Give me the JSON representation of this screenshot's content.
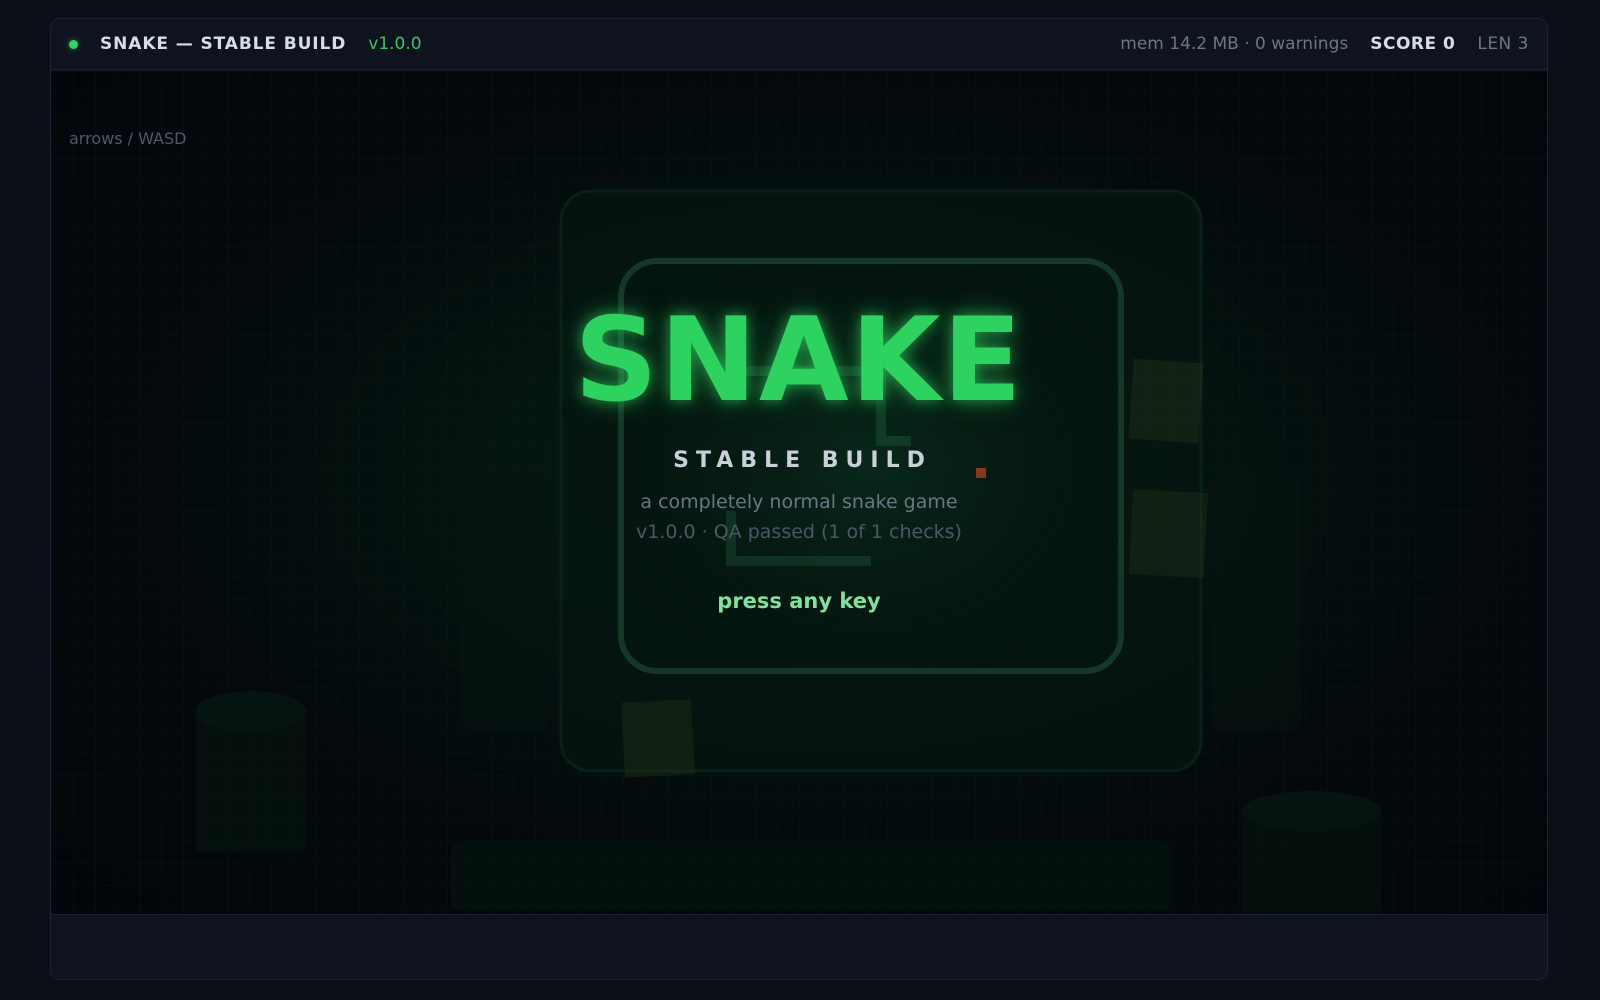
{
  "header": {
    "title": "SNAKE — STABLE BUILD",
    "version": "v1.0.0",
    "mem_status": "mem 14.2 MB · 0 warnings",
    "score": "SCORE 0",
    "length": "LEN 3",
    "status_color": "#2fd35f"
  },
  "game": {
    "controls_hint": "arrows / WASD",
    "title": "SNAKE",
    "subtitle": "STABLE BUILD",
    "tagline": "a completely normal snake game",
    "qa_line": "v1.0.0 · QA passed (1 of 1 checks)",
    "prompt": "press any key"
  },
  "colors": {
    "accent": "#2ed35f",
    "background": "#0b0f17",
    "food": "#c0392b"
  }
}
